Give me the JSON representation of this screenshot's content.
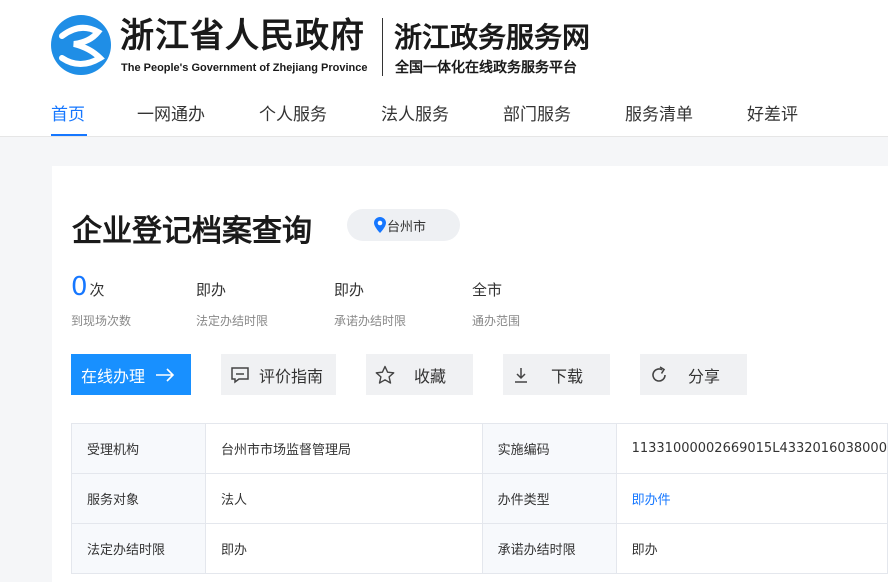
{
  "header": {
    "gov_name_cn": "浙江省人民政府",
    "gov_name_en": "The People's Government of Zhejiang Province",
    "portal_title": "浙江政务服务网",
    "portal_subtitle": "全国一体化在线政务服务平台"
  },
  "nav": {
    "items": [
      {
        "label": "首页",
        "active": true
      },
      {
        "label": "一网通办"
      },
      {
        "label": "个人服务"
      },
      {
        "label": "法人服务"
      },
      {
        "label": "部门服务"
      },
      {
        "label": "服务清单"
      },
      {
        "label": "好差评"
      }
    ]
  },
  "service": {
    "title": "企业登记档案查询",
    "location": "台州市",
    "stats": [
      {
        "number": "0",
        "value": "次",
        "label": "到现场次数"
      },
      {
        "value": "即办",
        "label": "法定办结时限"
      },
      {
        "value": "即办",
        "label": "承诺办结时限"
      },
      {
        "value": "全市",
        "label": "通办范围"
      }
    ],
    "actions": {
      "online": "在线办理",
      "guide": "评价指南",
      "favorite": "收藏",
      "download": "下载",
      "share": "分享"
    },
    "info": [
      [
        "受理机构",
        "台州市市场监督管理局",
        "实施编码",
        "11331000002669015L4332016038000"
      ],
      [
        "服务对象",
        "法人",
        "办件类型",
        "即办件"
      ],
      [
        "法定办结时限",
        "即办",
        "承诺办结时限",
        "即办"
      ]
    ]
  },
  "colors": {
    "accent": "#1677ff",
    "primary_button": "#1890ff"
  },
  "icons": [
    "zhejiang-gov-logo-icon",
    "location-pin-icon",
    "arrow-right-icon",
    "comment-icon",
    "star-icon",
    "download-icon",
    "share-icon"
  ]
}
